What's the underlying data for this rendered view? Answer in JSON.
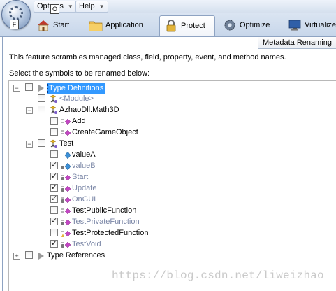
{
  "menu": {
    "options_label": "Options",
    "help_label": "Help",
    "keytip_options": "O",
    "keytip_file": "F"
  },
  "ribbon": {
    "tabs": [
      {
        "label": "Start",
        "icon": "house-icon"
      },
      {
        "label": "Application",
        "icon": "folder-icon"
      },
      {
        "label": "Protect",
        "icon": "padlock-icon",
        "active": true
      },
      {
        "label": "Optimize",
        "icon": "gear-icon"
      },
      {
        "label": "Virtualize",
        "icon": "monitor-icon"
      }
    ]
  },
  "panel": {
    "group_title": "Metadata Renaming",
    "description": "This feature scrambles managed class, field, property, event, and method names.",
    "prompt": "Select the symbols to be renamed below:"
  },
  "tree": [
    {
      "label": "Type Definitions",
      "checked": false,
      "expander": "minus",
      "selected": true,
      "icon": "play-arrow-icon"
    },
    {
      "label": "<Module>",
      "checked": false,
      "greyed": true,
      "icon": "class-icon"
    },
    {
      "label": "AzhaoDll.Math3D",
      "checked": false,
      "expander": "minus",
      "icon": "class-icon"
    },
    {
      "label": "Add",
      "checked": false,
      "icon": "method-icon"
    },
    {
      "label": "CreateGameObject",
      "checked": false,
      "icon": "method-icon"
    },
    {
      "label": "Test",
      "checked": false,
      "expander": "minus",
      "icon": "class-icon"
    },
    {
      "label": "valueA",
      "checked": false,
      "icon": "field-icon"
    },
    {
      "label": "valueB",
      "checked": true,
      "greyed": true,
      "icon": "private-field-icon"
    },
    {
      "label": "Start",
      "checked": true,
      "greyed": true,
      "icon": "private-method-icon"
    },
    {
      "label": "Update",
      "checked": true,
      "greyed": true,
      "icon": "private-method-icon"
    },
    {
      "label": "OnGUI",
      "checked": true,
      "greyed": true,
      "icon": "private-method-icon"
    },
    {
      "label": "TestPublicFunction",
      "checked": false,
      "icon": "method-icon"
    },
    {
      "label": "TestPrivateFunction",
      "checked": true,
      "greyed": true,
      "icon": "private-method-icon"
    },
    {
      "label": "TestProtectedFunction",
      "checked": false,
      "icon": "protected-method-icon"
    },
    {
      "label": "TestVoid",
      "checked": true,
      "greyed": true,
      "icon": "private-method-icon"
    },
    {
      "label": "Type References",
      "checked": false,
      "expander": "plus",
      "icon": "play-arrow-icon"
    }
  ],
  "watermark": "https://blog.csdn.net/liweizhao"
}
